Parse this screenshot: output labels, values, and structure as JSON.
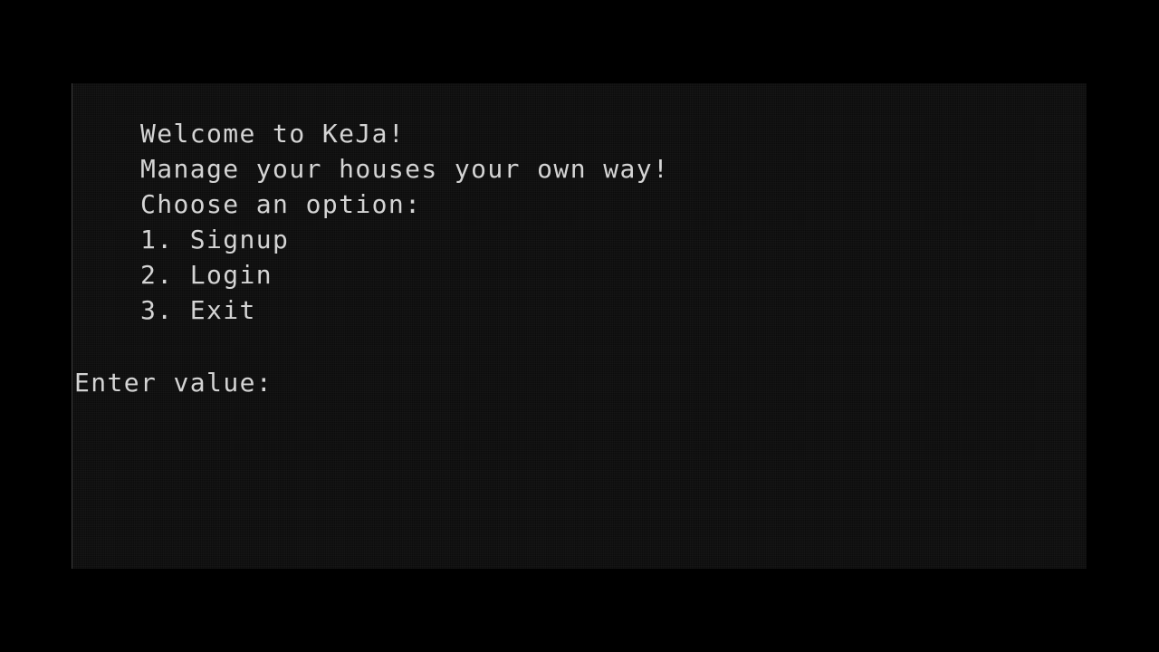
{
  "console": {
    "header": {
      "welcome": "Welcome to KeJa!",
      "tagline": "Manage your houses your own way!",
      "choose": "Choose an option:"
    },
    "menu": [
      {
        "label": "1. Signup"
      },
      {
        "label": "2. Login"
      },
      {
        "label": "3. Exit"
      }
    ],
    "prompt": {
      "label": "Enter value:",
      "value": ""
    },
    "colors": {
      "background": "#0c0c0c",
      "text": "#d4d4d4"
    }
  }
}
